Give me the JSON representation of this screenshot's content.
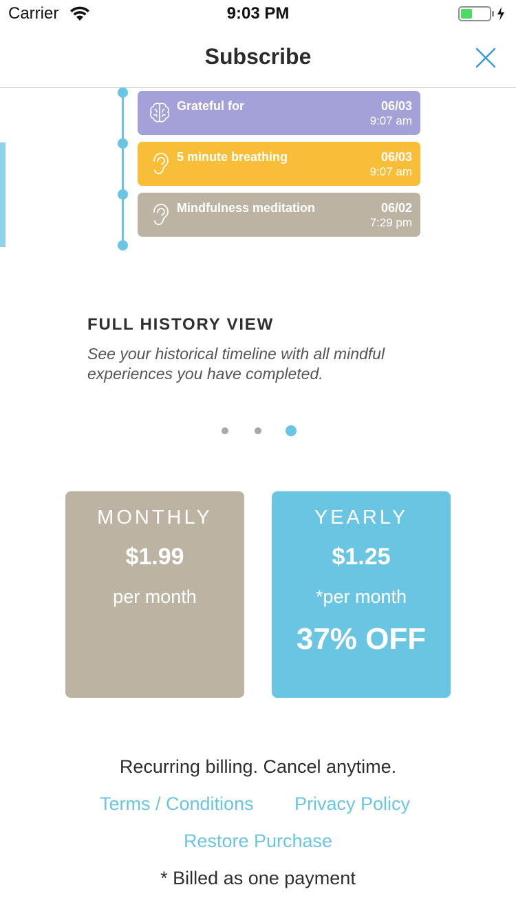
{
  "status_bar": {
    "carrier": "Carrier",
    "time": "9:03 PM",
    "icons": [
      "wifi-icon",
      "battery-icon",
      "charging-bolt-icon"
    ]
  },
  "nav": {
    "title": "Subscribe",
    "close_icon": "close-icon"
  },
  "timeline": {
    "entries": [
      {
        "title": "Grateful for",
        "date": "06/03",
        "time": "9:07 am",
        "icon": "brain-icon",
        "color": "#a3a1d7"
      },
      {
        "title": "5 minute breathing",
        "date": "06/03",
        "time": "9:07 am",
        "icon": "ear-icon",
        "color": "#f9be38"
      },
      {
        "title": "Mindfulness meditation",
        "date": "06/02",
        "time": "7:29 pm",
        "icon": "ear-icon",
        "color": "#bcb3a3"
      }
    ]
  },
  "feature": {
    "heading": "FULL HISTORY VIEW",
    "description": "See your historical timeline with all mindful experiences you have completed."
  },
  "pager": {
    "count": 3,
    "active_index": 2
  },
  "plans": {
    "monthly": {
      "name": "MONTHLY",
      "price": "$1.99",
      "period": "per month",
      "color": "#bcb3a3"
    },
    "yearly": {
      "name": "YEARLY",
      "price": "$1.25",
      "period": "*per month",
      "discount": "37% OFF",
      "color": "#6ac5e3"
    }
  },
  "footer": {
    "billing_note": "Recurring billing. Cancel anytime.",
    "terms_link": "Terms / Conditions",
    "privacy_link": "Privacy Policy",
    "restore_link": "Restore Purchase",
    "footnote": "* Billed as one payment"
  },
  "colors": {
    "accent": "#6ac5e3",
    "text_dark": "#2e2e2e"
  }
}
